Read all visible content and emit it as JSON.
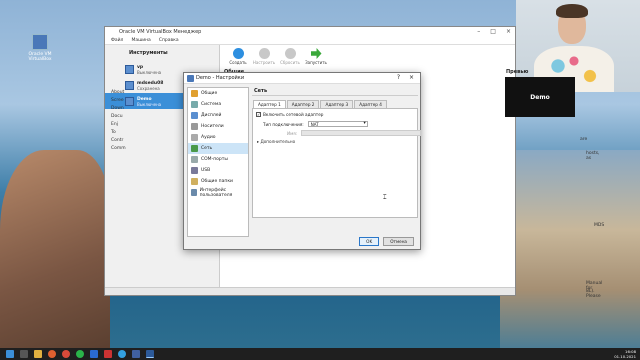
{
  "desktop": {
    "icon_label_1": "Oracle VM",
    "icon_label_2": "VirtualBox"
  },
  "manager": {
    "title": "Oracle VM VirtualBox Менеджер",
    "menu": [
      "Файл",
      "Машина",
      "Справка"
    ],
    "tools_label": "Инструменты",
    "vms": [
      {
        "name": "vp",
        "state": "Выключена"
      },
      {
        "name": "mdsedu08",
        "state": "Сохранена"
      },
      {
        "name": "Demo",
        "state": "Выключена"
      }
    ],
    "toolbar": [
      {
        "label": "Создать",
        "color": "#2d8fe0",
        "enabled": true
      },
      {
        "label": "Настроить",
        "color": "#c8c8c8",
        "enabled": false
      },
      {
        "label": "Сбросить",
        "color": "#c8c8c8",
        "enabled": false
      },
      {
        "label": "Запустить",
        "color": "#3aa83a",
        "enabled": true
      }
    ],
    "details_heading": "Общие",
    "preview_heading": "Превью",
    "preview_text": "Demo",
    "left_links": [
      "About",
      "Scree",
      "Down",
      "Docu",
      "Enj",
      "To",
      "Contr",
      "Comm"
    ],
    "right_text_1": "are",
    "right_text_2": "hosts, as",
    "right_text_3": "MDS",
    "right_text_4": "Manual for",
    "right_text_5": "8L). Please"
  },
  "dialog": {
    "title": "Demo - Настройки",
    "section_title": "Сеть",
    "nav": [
      {
        "label": "Общие",
        "color": "#e0a030"
      },
      {
        "label": "Система",
        "color": "#7aa"
      },
      {
        "label": "Дисплей",
        "color": "#5a8fd0"
      },
      {
        "label": "Носители",
        "color": "#999"
      },
      {
        "label": "Аудио",
        "color": "#aaa"
      },
      {
        "label": "Сеть",
        "color": "#4a9a4a"
      },
      {
        "label": "COM-порты",
        "color": "#9aa"
      },
      {
        "label": "USB",
        "color": "#7a7a9a"
      },
      {
        "label": "Общие папки",
        "color": "#d0b060"
      },
      {
        "label": "Интерфейс пользователя",
        "color": "#6a8aaa"
      }
    ],
    "tabs": [
      "Адаптер 1",
      "Адаптер 2",
      "Адаптер 3",
      "Адаптер 4"
    ],
    "enable_adapter_label": "Включить сетевой адаптер",
    "enable_adapter_checked": "✓",
    "attached_to_label": "Тип подключения:",
    "attached_to_value": "NAT",
    "name_label": "Имя:",
    "advanced_label": "Дополнительно",
    "ok_label": "OK",
    "cancel_label": "Отмена"
  },
  "taskbar": {
    "time": "16:08",
    "date": "01.10.2021"
  }
}
